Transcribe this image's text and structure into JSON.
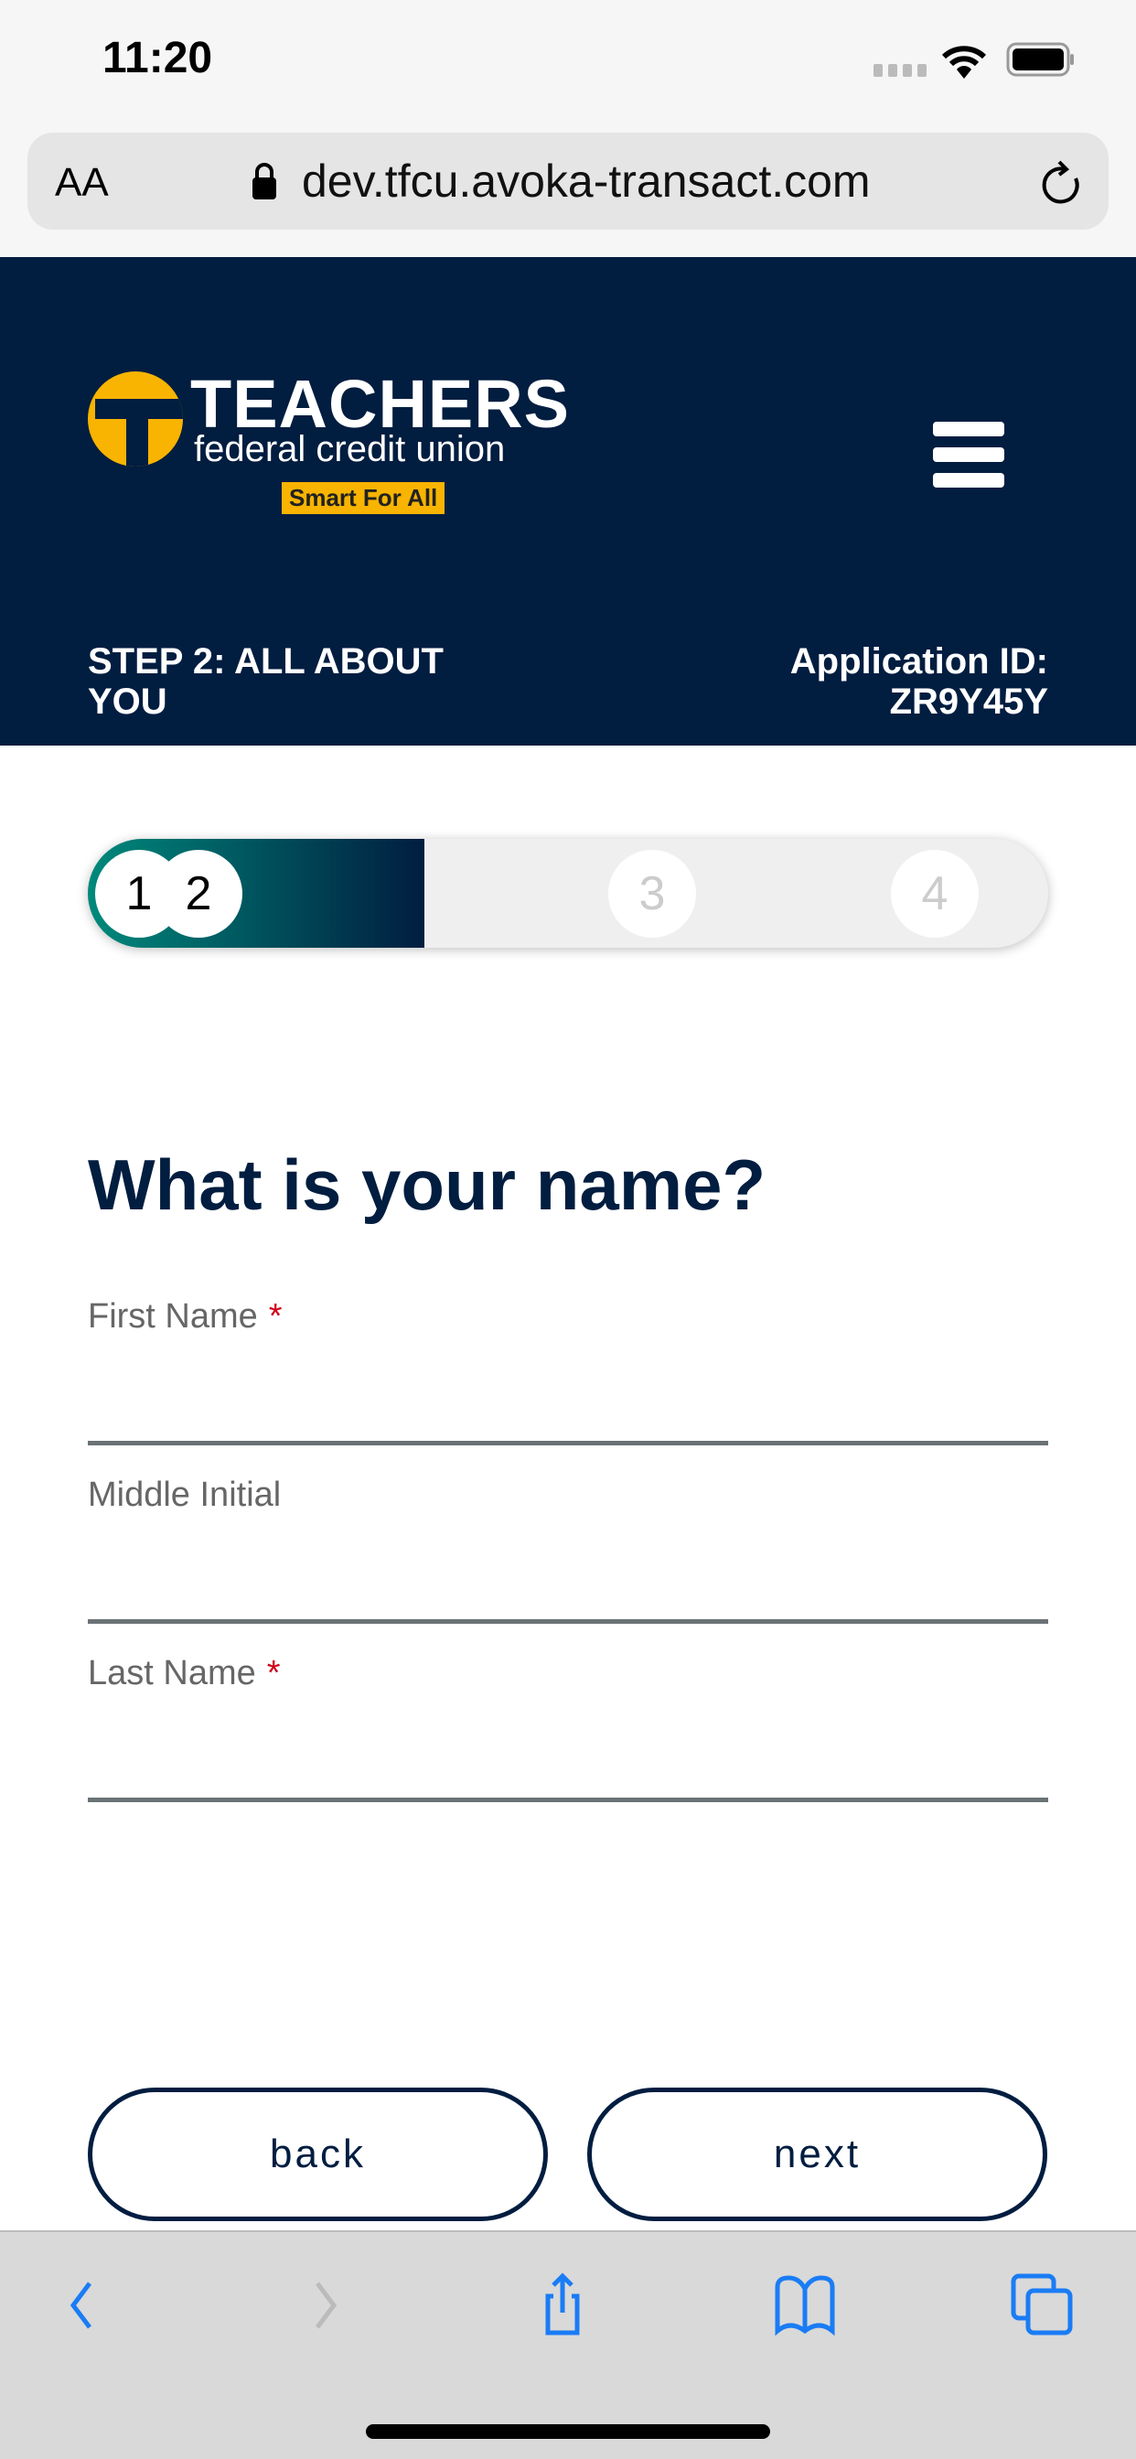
{
  "status_bar": {
    "time": "11:20"
  },
  "browser": {
    "text_size_label": "AA",
    "url": "dev.tfcu.avoka-transact.com"
  },
  "header": {
    "logo_title": "TEACHERS",
    "logo_subtitle": "federal credit union",
    "logo_tagline": "Smart For All",
    "step_label": "STEP 2: ALL ABOUT YOU",
    "app_id_label": "Application ID:",
    "app_id": "ZR9Y45Y"
  },
  "progress": {
    "steps": [
      "1",
      "2",
      "3",
      "4"
    ],
    "current_step": 2,
    "fill_percent": 35,
    "colors": {
      "start": "#00897b",
      "end": "#011d40"
    }
  },
  "form": {
    "title": "What is your name?",
    "fields": [
      {
        "label": "First Name",
        "required": "*",
        "value": ""
      },
      {
        "label": "Middle Initial",
        "value": ""
      },
      {
        "label": "Last Name",
        "required": "*",
        "value": ""
      }
    ]
  },
  "actions": {
    "back": "back",
    "next": "next"
  },
  "colors": {
    "navy": "#011d40",
    "accent": "#f8b400",
    "ios_blue": "#1a7cf5"
  }
}
